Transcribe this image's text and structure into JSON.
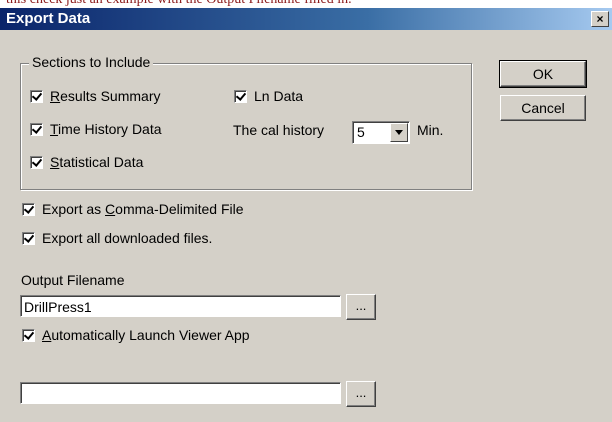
{
  "page_caption": "this check just an example with the Output Filename filled in.",
  "dialog": {
    "title": "Export Data",
    "close_label": "×"
  },
  "sections_group": {
    "legend": "Sections to Include",
    "results_summary": {
      "pre": "",
      "mnemonic": "R",
      "post": "esults Summary",
      "checked": true
    },
    "ln_data": {
      "label": "Ln Data",
      "checked": true
    },
    "time_history": {
      "pre": "",
      "mnemonic": "T",
      "post": "ime History Data",
      "checked": true
    },
    "cal_history_label": "The cal history",
    "cal_history_value": "5",
    "cal_history_unit": "Min.",
    "statistical": {
      "pre": "",
      "mnemonic": "S",
      "post": "tatistical Data",
      "checked": true
    }
  },
  "buttons": {
    "ok": "OK",
    "cancel": "Cancel"
  },
  "export_csv": {
    "pre": "Export as ",
    "mnemonic": "C",
    "post": "omma-Delimited File",
    "checked": true
  },
  "export_all": {
    "label": "Export all downloaded files.",
    "checked": true
  },
  "output": {
    "label": "Output Filename",
    "value": "DrillPress1",
    "browse_label": "..."
  },
  "launch_viewer": {
    "pre": "",
    "mnemonic": "A",
    "post": "utomatically Launch Viewer App",
    "checked": true,
    "value": "",
    "browse_label": "..."
  }
}
